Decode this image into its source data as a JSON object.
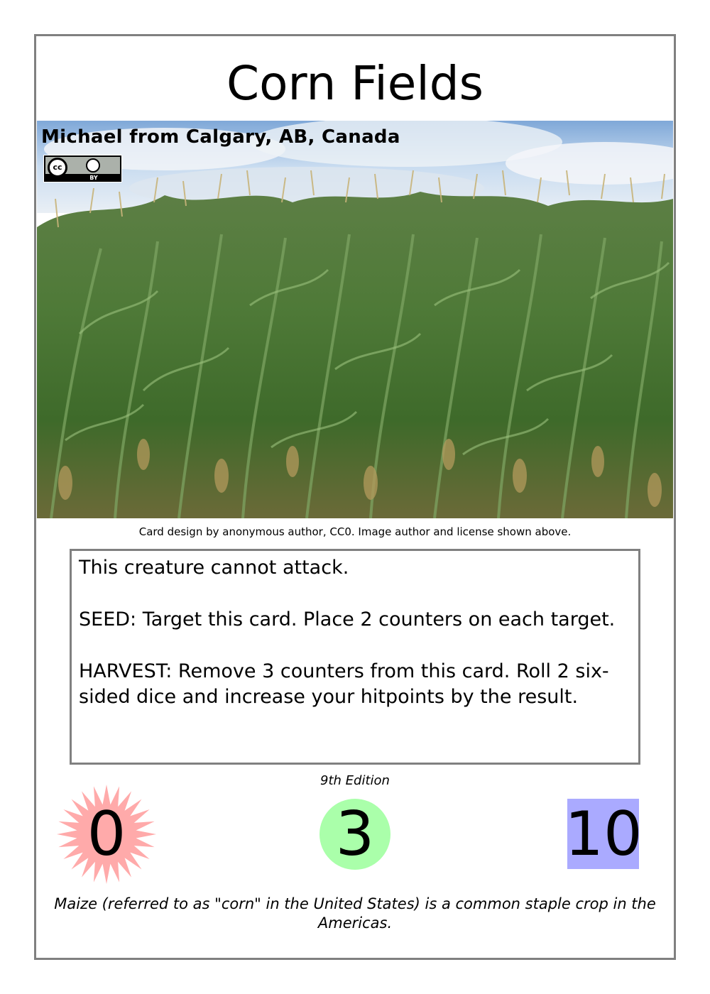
{
  "card": {
    "title": "Corn Fields",
    "image_author": "Michael from Calgary, AB, Canada",
    "license_badge": {
      "icon": "cc-by-icon",
      "label": "BY"
    },
    "credit_line": "Card design by anonymous author, CC0. Image author and license shown above.",
    "rules_text": [
      "This creature cannot attack.",
      "SEED: Target this card. Place 2 counters on each target.",
      "HARVEST: Remove 3 counters from this card. Roll 2 six-sided dice and increase your hitpoints by the result."
    ],
    "edition": "9th Edition",
    "stats": {
      "attack": "0",
      "cost": "3",
      "hitpoints": "10"
    },
    "flavor_text": "Maize (referred to as \"corn\" in the United States) is a common staple crop in the Americas."
  },
  "colors": {
    "border": "#808080",
    "attack_star": "#ffaaaa",
    "cost_circle": "#aaffaa",
    "hitpoints_square": "#aaaaff"
  }
}
